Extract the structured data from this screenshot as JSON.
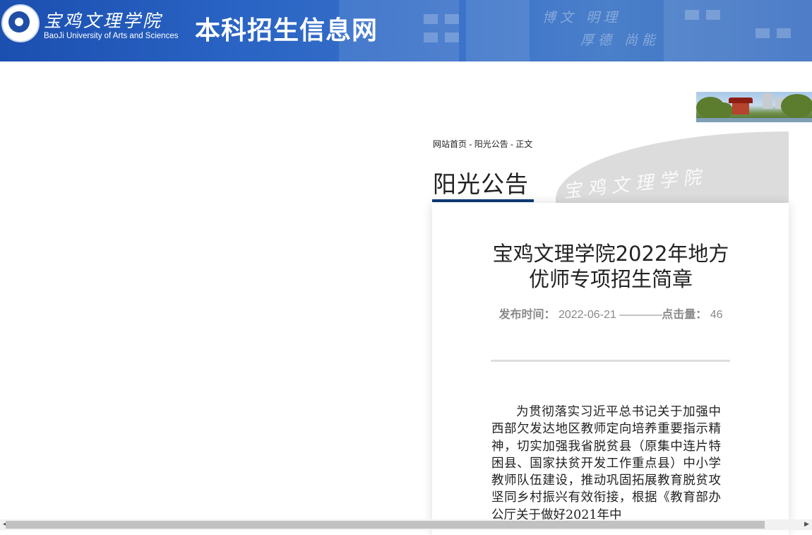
{
  "header": {
    "logo_icon": "university-seal-logo",
    "school_name_cn": "宝鸡文理学院",
    "school_name_en": "BaoJi University of Arts and Sciences",
    "site_title": "本科招生信息网",
    "motto_line1": "博文  明理",
    "motto_line2": "厚德  尚能",
    "colors": {
      "banner": "#2a64c4",
      "accent": "#0b3a7a"
    }
  },
  "breadcrumb": {
    "home": "网站首页",
    "sep1": " - ",
    "category": "阳光公告",
    "sep2": " - ",
    "current": "正文"
  },
  "section": {
    "title": "阳光公告",
    "calligraphy": "宝鸡文理学院"
  },
  "article": {
    "title": "宝鸡文理学院2022年地方优师专项招生简章",
    "date_label": "发布时间：",
    "date_value": "2022-06-21",
    "dashes": "————",
    "views_label": "点击量：",
    "views_value": "46",
    "body": "为贯彻落实习近平总书记关于加强中西部欠发达地区教师定向培养重要指示精神，切实加强我省脱贫县（原集中连片特困县、国家扶贫开发工作重点县）中小学教师队伍建设，推动巩固拓展教育脱贫攻坚同乡村振兴有效衔接，根据《教育部办公厅关于做好2021年中"
  },
  "scrollbar": {
    "left_arrow": "◀",
    "right_arrow": "▶"
  }
}
